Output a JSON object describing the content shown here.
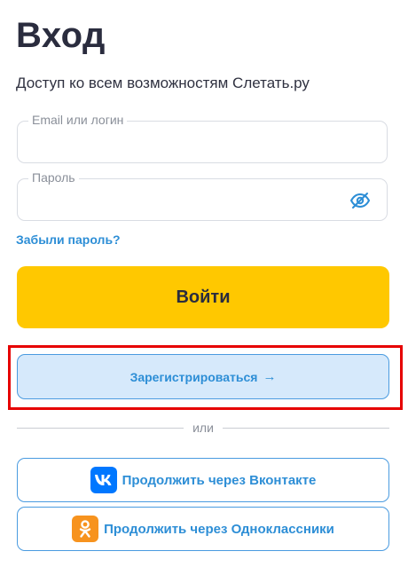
{
  "header": {
    "title": "Вход",
    "subtitle": "Доступ ко всем возможностям Слетать.ру"
  },
  "form": {
    "login_label": "Email или логин",
    "login_value": "",
    "password_label": "Пароль",
    "password_value": "",
    "password_toggle_icon": "eye-slash-icon",
    "forgot_link": "Забыли пароль?",
    "submit_label": "Войти"
  },
  "register": {
    "label": "Зарегистрироваться",
    "arrow": "→"
  },
  "divider": {
    "text": "или"
  },
  "social": {
    "vk_label": "Продолжить через Вконтакте",
    "vk_icon": "vk-icon",
    "ok_label": "Продолжить через Одноклассники",
    "ok_icon": "odnoklassniki-icon"
  },
  "colors": {
    "accent_yellow": "#ffc800",
    "link_blue": "#2d8ed6",
    "register_bg": "#d6e9fb",
    "highlight_red": "#e60000",
    "vk_blue": "#0077ff",
    "ok_orange": "#f7931e"
  }
}
